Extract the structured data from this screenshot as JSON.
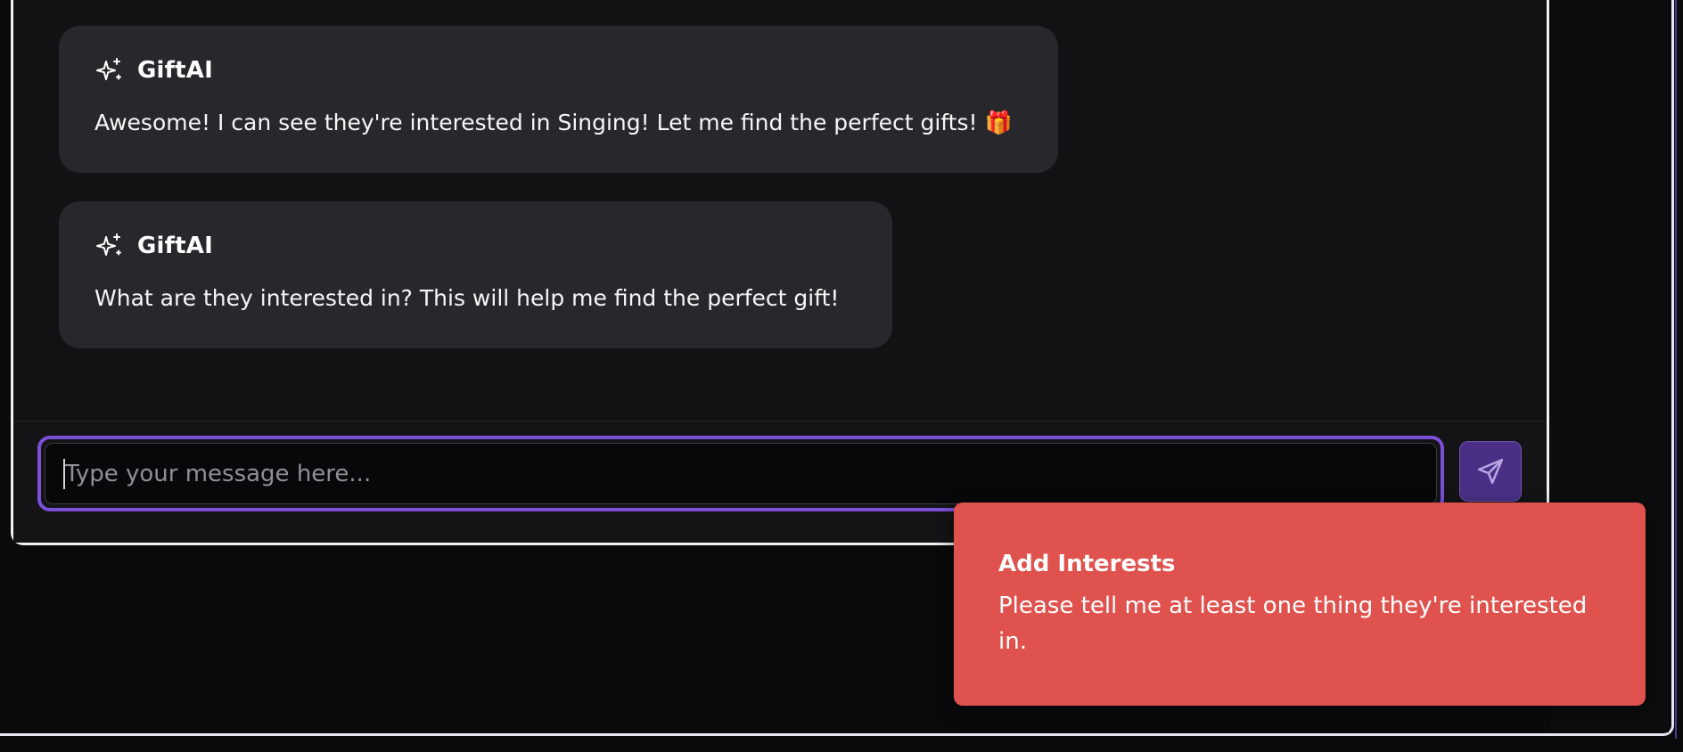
{
  "chat": {
    "messages": [
      {
        "sender": "GiftAI",
        "icon": "sparkles-icon",
        "text": "Awesome! I can see they're interested in Singing! Let me find the perfect gifts! 🎁"
      },
      {
        "sender": "GiftAI",
        "icon": "sparkles-icon",
        "text": "What are they interested in? This will help me find the perfect gift!"
      }
    ]
  },
  "composer": {
    "placeholder": "Type your message here...",
    "value": "",
    "send_icon": "send-icon"
  },
  "toast": {
    "title": "Add Interests",
    "description": "Please tell me at least one thing they're interested in."
  },
  "colors": {
    "accent": "#7c4fd9",
    "toast_bg": "#df524d",
    "bubble_bg": "#28282c",
    "panel_bg": "#121214"
  }
}
